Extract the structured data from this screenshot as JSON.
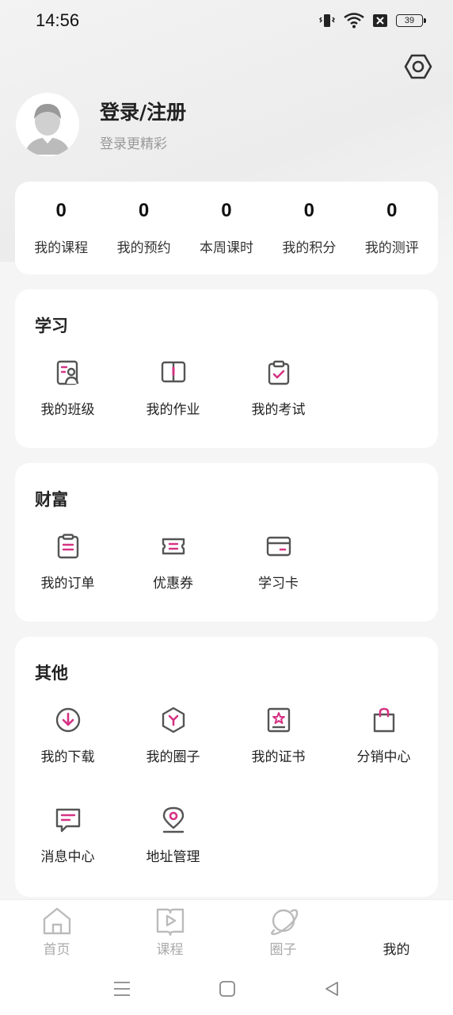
{
  "status": {
    "time": "14:56",
    "battery": "39"
  },
  "colors": {
    "accent": "#d63384",
    "icon_dark": "#555555"
  },
  "profile": {
    "title": "登录/注册",
    "subtitle": "登录更精彩"
  },
  "stats": [
    {
      "value": "0",
      "label": "我的课程"
    },
    {
      "value": "0",
      "label": "我的预约"
    },
    {
      "value": "0",
      "label": "本周课时"
    },
    {
      "value": "0",
      "label": "我的积分"
    },
    {
      "value": "0",
      "label": "我的测评"
    }
  ],
  "sections": {
    "study": {
      "title": "学习",
      "items": [
        {
          "label": "我的班级",
          "icon": "class-icon"
        },
        {
          "label": "我的作业",
          "icon": "homework-icon"
        },
        {
          "label": "我的考试",
          "icon": "exam-icon"
        }
      ]
    },
    "wealth": {
      "title": "财富",
      "items": [
        {
          "label": "我的订单",
          "icon": "order-icon"
        },
        {
          "label": "优惠券",
          "icon": "coupon-icon"
        },
        {
          "label": "学习卡",
          "icon": "card-icon"
        }
      ]
    },
    "other": {
      "title": "其他",
      "items": [
        {
          "label": "我的下载",
          "icon": "download-icon"
        },
        {
          "label": "我的圈子",
          "icon": "circle-icon"
        },
        {
          "label": "我的证书",
          "icon": "certificate-icon"
        },
        {
          "label": "分销中心",
          "icon": "bag-icon"
        },
        {
          "label": "消息中心",
          "icon": "message-icon"
        },
        {
          "label": "地址管理",
          "icon": "location-icon"
        }
      ]
    }
  },
  "tabs": [
    {
      "label": "首页",
      "icon": "home-icon"
    },
    {
      "label": "课程",
      "icon": "course-icon"
    },
    {
      "label": "圈子",
      "icon": "planet-icon"
    },
    {
      "label": "我的",
      "active": true
    }
  ]
}
